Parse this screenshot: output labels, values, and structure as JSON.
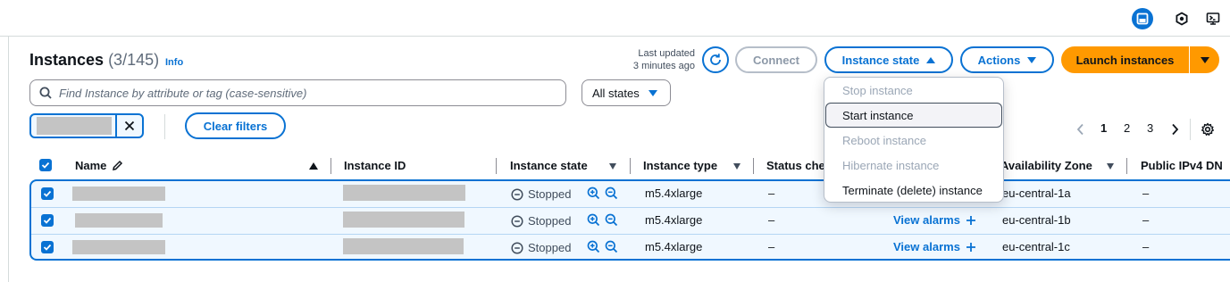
{
  "header": {
    "title": "Instances",
    "count": "(3/145)",
    "info_link": "Info",
    "last_updated_line1": "Last updated",
    "last_updated_line2": "3 minutes ago"
  },
  "toolbar": {
    "connect": "Connect",
    "instance_state": "Instance state",
    "actions": "Actions",
    "launch": "Launch instances"
  },
  "search": {
    "placeholder": "Find Instance by attribute or tag (case-sensitive)"
  },
  "states_filter": {
    "selected": "All states"
  },
  "filters": {
    "clear": "Clear filters"
  },
  "pagination": {
    "pages": [
      "1",
      "2",
      "3"
    ],
    "current": "1"
  },
  "table": {
    "columns": {
      "name": "Name",
      "instance_id": "Instance ID",
      "instance_state": "Instance state",
      "instance_type": "Instance type",
      "status_check": "Status che",
      "availability_zone": "Availability Zone",
      "public_ipv4": "Public IPv4 DN"
    },
    "rows": [
      {
        "state": "Stopped",
        "type": "m5.4xlarge",
        "status": "–",
        "alarms": "",
        "az": "eu-central-1a",
        "ipv4": "–"
      },
      {
        "state": "Stopped",
        "type": "m5.4xlarge",
        "status": "–",
        "alarms": "View alarms",
        "az": "eu-central-1b",
        "ipv4": "–"
      },
      {
        "state": "Stopped",
        "type": "m5.4xlarge",
        "status": "–",
        "alarms": "View alarms",
        "az": "eu-central-1c",
        "ipv4": "–"
      }
    ]
  },
  "state_menu": {
    "items": [
      {
        "label": "Stop instance",
        "enabled": false
      },
      {
        "label": "Start instance",
        "enabled": true
      },
      {
        "label": "Reboot instance",
        "enabled": false
      },
      {
        "label": "Hibernate instance",
        "enabled": false
      },
      {
        "label": "Terminate (delete) instance",
        "enabled": true
      }
    ]
  },
  "colors": {
    "accent": "#0972d3",
    "primary_button": "#ff9900",
    "selected_row_bg": "#f0f8ff"
  }
}
